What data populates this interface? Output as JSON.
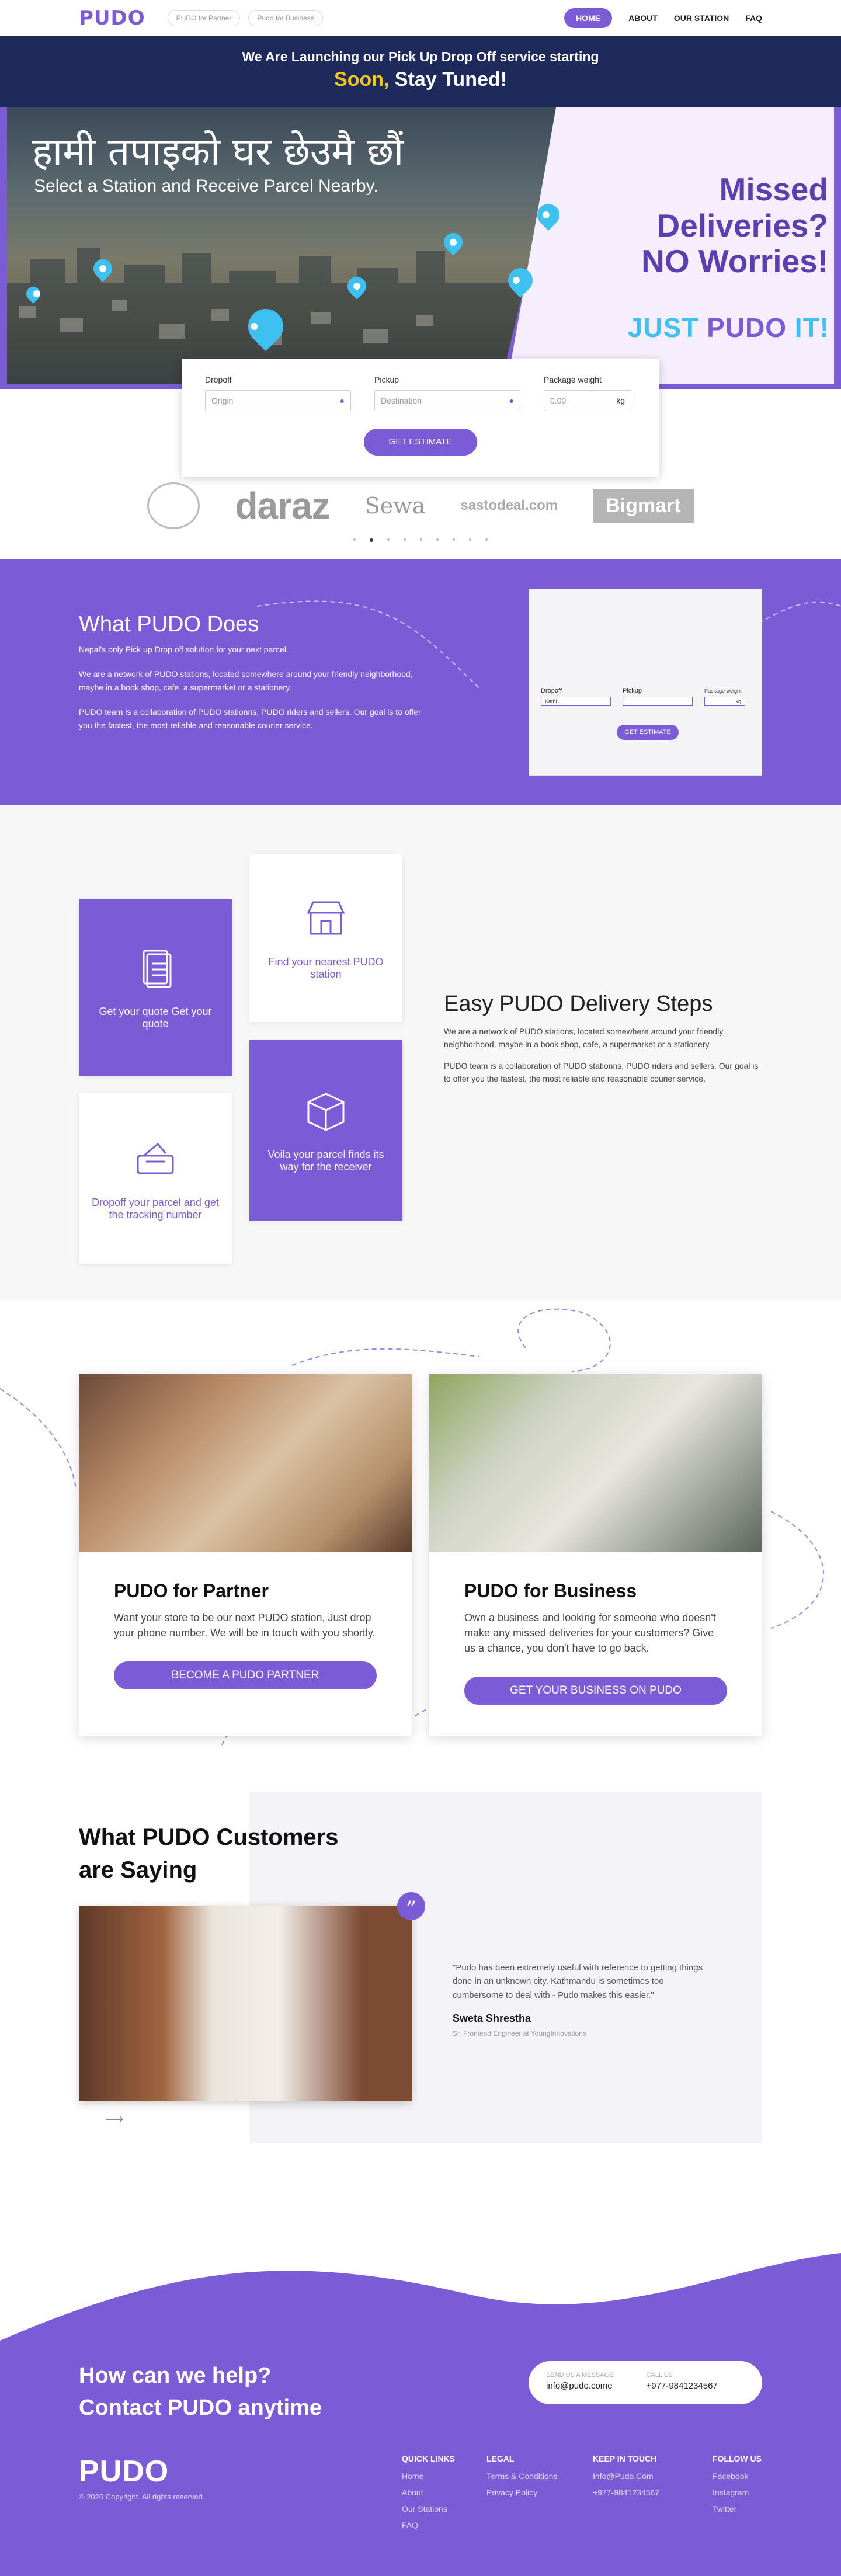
{
  "nav": {
    "logo": "PUDO",
    "pill_partner": "PUDO for Partner",
    "pill_business": "Pudo for Business",
    "menu": [
      "HOME",
      "ABOUT",
      "OUR STATION",
      "FAQ"
    ]
  },
  "announce": {
    "line1": "We Are Launching our Pick Up Drop Off service starting",
    "soon": "Soon,",
    "rest": "Stay Tuned!"
  },
  "hero": {
    "title": "हामी तपाइको घर छेउमै छौं",
    "subtitle": "Select a Station and Receive Parcel Nearby.",
    "missed": [
      "Missed",
      "Deliveries?",
      "NO Worries!"
    ],
    "just": "JUST",
    "pudo": "PUDO",
    "it": "IT!"
  },
  "estimate": {
    "dropoff_label": "Dropoff",
    "dropoff_placeholder": "Origin",
    "pickup_label": "Pickup",
    "pickup_placeholder": "Destination",
    "weight_label": "Package weight",
    "weight_placeholder": "0.00",
    "weight_unit": "kg",
    "button": "GET ESTIMATE"
  },
  "brands": {
    "daraz": "daraz",
    "sewa": "Sewa",
    "sasto": "sastodeal.com",
    "bigmart": "Bigmart"
  },
  "what": {
    "title": "What PUDO Does",
    "p1": "Nepal's only Pick up Drop off solution for your next parcel.",
    "p2": "We are a network of PUDO stations, located somewhere around your friendly neighborhood, maybe in a book shop, cafe, a supermarket or a stationery.",
    "p3": "PUDO team is a collaboration of PUDO stationns, PUDO riders and sellers. Our goal is to offer you the fastest, the most reliable and reasonable courier service.",
    "snap_dropoff": "Dropoff",
    "snap_dropoff_value": "Kathi",
    "snap_pickup": "Pickup",
    "snap_weight": "Package weight",
    "snap_unit": "kg",
    "snap_button": "GET ESTIMATE"
  },
  "steps": {
    "tiles": [
      "Get your quote Get your quote",
      "Find your nearest PUDO station",
      "Dropoff your parcel and get the tracking number",
      "Voila your parcel finds its way for the receiver"
    ],
    "title": "Easy PUDO Delivery Steps",
    "p1": "We are a network of PUDO stations, located somewhere around your friendly neighborhood, maybe in a book shop, cafe, a supermarket or a stationery.",
    "p2": "PUDO team is a collaboration of PUDO stationns, PUDO riders and sellers. Our goal is to offer you the fastest, the most reliable and reasonable courier service."
  },
  "partner": {
    "title": "PUDO for Partner",
    "text": "Want your store to be our next PUDO station, Just drop your phone number. We will be in touch with you shortly.",
    "button": "BECOME A PUDO PARTNER"
  },
  "business": {
    "title": "PUDO for Business",
    "text": "Own a business and looking for someone who doesn't make any missed deliveries for your customers? Give us a chance, you don't have to go back.",
    "button": "GET YOUR BUSINESS ON PUDO"
  },
  "testimonial": {
    "heading_1": "What PUDO Customers",
    "heading_2": "are Saying",
    "quote": "\"Pudo has been extremely useful with reference to getting things done in an unknown city. Kathmandu is sometimes too cumbersome to deal with - Pudo makes this easier.\"",
    "name": "Sweta Shrestha",
    "role": "Sr. Frontend Engineer at YoungInnovations"
  },
  "footer": {
    "help_1": "How can we help?",
    "help_2": "Contact PUDO anytime",
    "msg_label": "Send us a message",
    "msg_value": "info@pudo.come",
    "call_label": "Call us",
    "call_value": "+977-9841234567",
    "logo": "PUDO",
    "copyright": "© 2020 Copyright. All rights reserved.",
    "quick_links_title": "QUICK LINKS",
    "quick_links": [
      "Home",
      "About",
      "Our Stations",
      "FAQ"
    ],
    "legal_title": "LEGAL",
    "legal": [
      "Terms & Conditions",
      "Privacy Policy"
    ],
    "touch_title": "KEEP IN TOUCH",
    "touch": [
      "Info@Pudo.Com",
      "+977-9841234567"
    ],
    "follow_title": "FOLLOW US",
    "follow": [
      "Facebook",
      "Instagram",
      "Twitter"
    ]
  },
  "colors": {
    "brand": "#7b5bd6",
    "navy": "#1f2a5c",
    "accent_yellow": "#f5c518",
    "accent_cyan": "#3ec1f0"
  }
}
